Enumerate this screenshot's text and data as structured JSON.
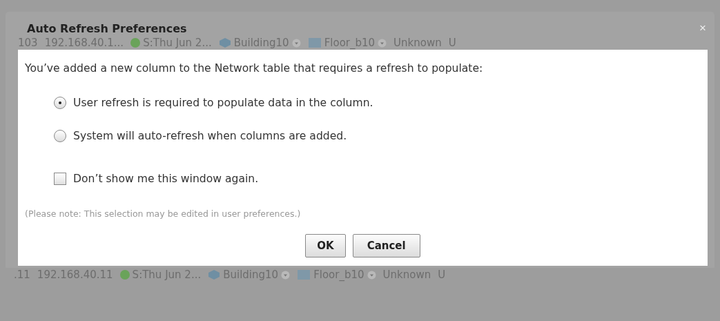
{
  "background_rows": [
    {
      "cells": [
        "103",
        "192.168.40.1...",
        "S:Thu Jun 2...",
        "Building10",
        "Floor_b10",
        "Unknown",
        "U"
      ]
    },
    {
      "cells": [
        ".11",
        "192.168.40.11",
        "S:Thu Jun 2...",
        "Building10",
        "Floor_b10",
        "Unknown",
        "U"
      ]
    }
  ],
  "dialog": {
    "title": "Auto Refresh Preferences",
    "close": "×",
    "message": "You’ve added a new column to the Network table that requires a refresh to populate:",
    "options": [
      {
        "label": "User refresh is required to populate data in the column.",
        "selected": true
      },
      {
        "label": "System will auto-refresh when columns are added.",
        "selected": false
      }
    ],
    "dont_show": {
      "label": "Don’t show me this window again.",
      "checked": false
    },
    "note": "(Please note: This selection may be edited in user preferences.)",
    "buttons": [
      "OK",
      "Cancel"
    ]
  }
}
